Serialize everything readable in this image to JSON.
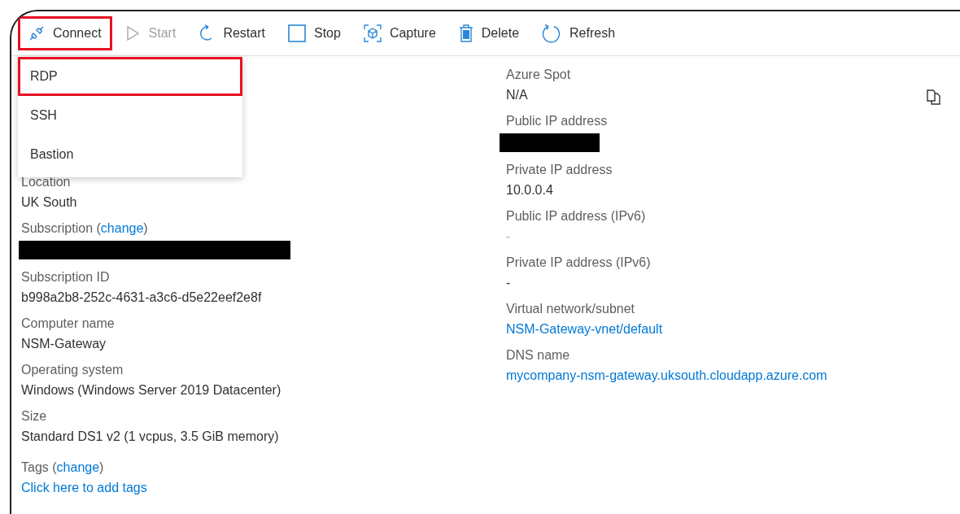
{
  "toolbar": [
    {
      "kind": "connect",
      "label": "Connect",
      "disabled": false,
      "highlighted": true
    },
    {
      "kind": "start",
      "label": "Start",
      "disabled": true,
      "highlighted": false
    },
    {
      "kind": "restart",
      "label": "Restart",
      "disabled": false,
      "highlighted": false
    },
    {
      "kind": "stop",
      "label": "Stop",
      "disabled": false,
      "highlighted": false
    },
    {
      "kind": "capture",
      "label": "Capture",
      "disabled": false,
      "highlighted": false
    },
    {
      "kind": "delete",
      "label": "Delete",
      "disabled": false,
      "highlighted": false
    },
    {
      "kind": "refresh",
      "label": "Refresh",
      "disabled": false,
      "highlighted": false
    }
  ],
  "connect_menu": {
    "expanded": true,
    "items": [
      {
        "label": "RDP",
        "highlighted": true
      },
      {
        "label": "SSH",
        "highlighted": false
      },
      {
        "label": "Bastion",
        "highlighted": false
      }
    ]
  },
  "left_properties": [
    {
      "label": "Location",
      "value": "UK South"
    },
    {
      "label": "Subscription",
      "link_open": "(",
      "link": "change",
      "link_close": ")",
      "redacted": true
    },
    {
      "label": "Subscription ID",
      "value": "b998a2b8-252c-4631-a3c6-d5e22eef2e8f"
    },
    {
      "label": "Computer name",
      "value": "NSM-Gateway"
    },
    {
      "label": "Operating system",
      "value": "Windows (Windows Server 2019 Datacenter)"
    },
    {
      "label": "Size",
      "value": "Standard DS1 v2 (1 vcpus, 3.5 GiB memory)"
    },
    {
      "label": "Tags",
      "link_open": "(",
      "link": "change",
      "link_close": ")",
      "value": "Click here to add tags",
      "value_is_link": true
    }
  ],
  "right_properties": [
    {
      "label": "Azure Spot",
      "value": "N/A"
    },
    {
      "label": "Public IP address",
      "redacted": true
    },
    {
      "label": "Private IP address",
      "value": "10.0.0.4"
    },
    {
      "label": "Public IP address (IPv6)",
      "value": "-",
      "muted": true
    },
    {
      "label": "Private IP address (IPv6)",
      "value": "-"
    },
    {
      "label": "Virtual network/subnet",
      "value": "NSM-Gateway-vnet/default",
      "value_is_link": true
    },
    {
      "label": "DNS name",
      "value": "mycompany-nsm-gateway.uksouth.cloudapp.azure.com",
      "value_is_link": true
    }
  ]
}
